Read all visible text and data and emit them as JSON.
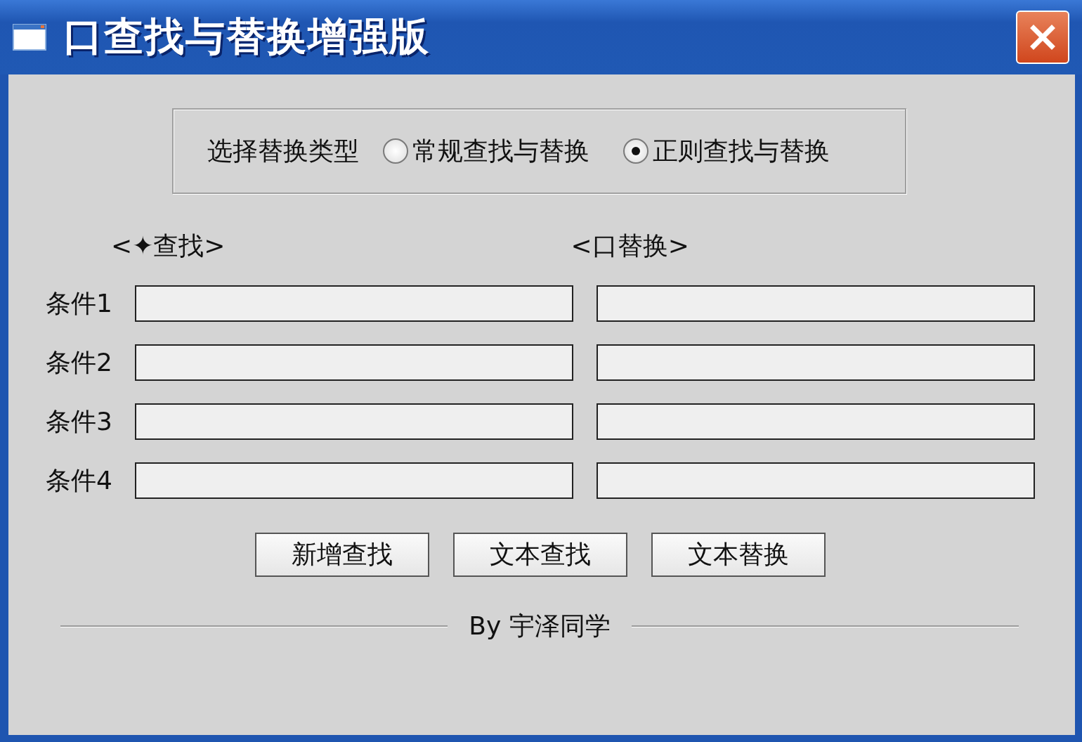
{
  "window": {
    "title": "口查找与替换增强版"
  },
  "replace_type": {
    "label": "选择替换类型",
    "options": [
      {
        "label": "常规查找与替换",
        "selected": false
      },
      {
        "label": "正则查找与替换",
        "selected": true
      }
    ]
  },
  "headers": {
    "find": "<✦查找>",
    "replace": "<口替换>"
  },
  "conditions": [
    {
      "label": "条件1"
    },
    {
      "label": "条件2"
    },
    {
      "label": "条件3"
    },
    {
      "label": "条件4"
    }
  ],
  "buttons": [
    "新增查找",
    "文本查找",
    "文本替换"
  ],
  "footer": "By 宇泽同学"
}
